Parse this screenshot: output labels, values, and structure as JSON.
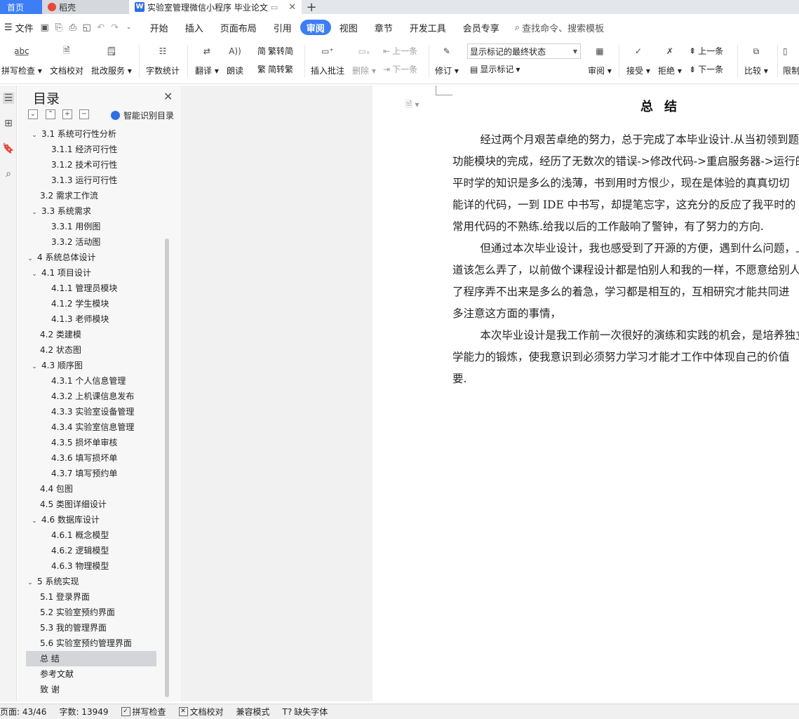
{
  "tabs": {
    "home": "首页",
    "daoke": "稻壳",
    "document": "实验室管理微信小程序 毕业论文",
    "add": "+"
  },
  "menubar": {
    "file": "文件",
    "items": [
      "开始",
      "插入",
      "页面布局",
      "引用",
      "审阅",
      "视图",
      "章节",
      "开发工具",
      "会员专享"
    ],
    "active": "审阅",
    "search": "查找命令、搜索模板"
  },
  "ribbon": {
    "spellcheck": "拼写检查",
    "doc_proof": "文档校对",
    "review_service": "批改服务",
    "word_count": "字数统计",
    "translate": "翻译",
    "read_aloud": "朗读",
    "trad_simp": "繁转简",
    "simp_trad": "简转繁",
    "insert_comment": "插入批注",
    "delete": "删除",
    "prev_comment": "上一条",
    "next_comment": "下一条",
    "revise": "修订",
    "show_markup_mode": "显示标记的最终状态",
    "show_markup": "显示标记",
    "review": "审阅",
    "accept": "接受",
    "reject": "拒绝",
    "prev_change": "上一条",
    "next_change": "下一条",
    "compare": "比较",
    "restrict": "限制"
  },
  "toc": {
    "title": "目录",
    "smart_detect": "智能识别目录",
    "items": [
      {
        "label": "3.1 系统可行性分析",
        "level": 2,
        "expanded": true
      },
      {
        "label": "3.1.1 经济可行性",
        "level": 3
      },
      {
        "label": "3.1.2 技术可行性",
        "level": 3
      },
      {
        "label": "3.1.3 运行可行性",
        "level": 3
      },
      {
        "label": "3.2 需求工作流",
        "level": 2
      },
      {
        "label": "3.3 系统需求",
        "level": 2,
        "expanded": true
      },
      {
        "label": "3.3.1 用例图",
        "level": 3
      },
      {
        "label": "3.3.2 活动图",
        "level": 3
      },
      {
        "label": "4 系统总体设计",
        "level": 1,
        "expanded": true
      },
      {
        "label": "4.1 项目设计",
        "level": 2,
        "expanded": true
      },
      {
        "label": "4.1.1 管理员模块",
        "level": 3
      },
      {
        "label": "4.1.2 学生模块",
        "level": 3
      },
      {
        "label": "4.1.3 老师模块",
        "level": 3
      },
      {
        "label": "4.2 类建模",
        "level": 2
      },
      {
        "label": "4.2  状态图",
        "level": 2
      },
      {
        "label": "4.3  顺序图",
        "level": 2,
        "expanded": true
      },
      {
        "label": "4.3.1 个人信息管理",
        "level": 3
      },
      {
        "label": "4.3.2 上机课信息发布",
        "level": 3
      },
      {
        "label": "4.3.3 实验室设备管理",
        "level": 3
      },
      {
        "label": "4.3.4 实验室信息管理",
        "level": 3
      },
      {
        "label": "4.3.5 损坏单审核",
        "level": 3
      },
      {
        "label": "4.3.6 填写损坏单",
        "level": 3
      },
      {
        "label": "4.3.7 填写预约单",
        "level": 3
      },
      {
        "label": "4.4  包图",
        "level": 2
      },
      {
        "label": "4.5 类图详细设计",
        "level": 2
      },
      {
        "label": "4.6  数据库设计",
        "level": 2,
        "expanded": true
      },
      {
        "label": "4.6.1  概念模型",
        "level": 3
      },
      {
        "label": "4.6.2  逻辑模型",
        "level": 3
      },
      {
        "label": "4.6.3  物理模型",
        "level": 3
      },
      {
        "label": "5 系统实现",
        "level": 1,
        "expanded": true
      },
      {
        "label": "5.1 登录界面",
        "level": 2
      },
      {
        "label": "5.2  实验室预约界面",
        "level": 2
      },
      {
        "label": "5.3  我的管理界面",
        "level": 2
      },
      {
        "label": "5.6  实验室预约管理界面",
        "level": 2
      },
      {
        "label": "总   结",
        "level": 1,
        "selected": true
      },
      {
        "label": "参考文献",
        "level": 1
      },
      {
        "label": "致   谢",
        "level": 1
      }
    ]
  },
  "document": {
    "heading": "总结",
    "paragraphs": [
      [
        "        经过两个月艰苦卓绝的努力，总于完成了本毕业设计.从当初领到题",
        "功能模块的完成，经历了无数次的错误->修改代码->重启服务器->运行的",
        "平时学的知识是多么的浅薄，书到用时方恨少，现在是体验的真真切切",
        "能详的代码，一到 IDE 中书写，却提笔忘字，这充分的反应了我平时的",
        "常用代码的不熟练.给我以后的工作敲响了警钟，有了努力的方向."
      ],
      [
        "        但通过本次毕业设计，我也感受到了开源的方便，遇到什么问题，上",
        "道该怎么弄了，以前做个课程设计都是怕别人和我的一样，不愿意给别人",
        "了程序弄不出来是多么的着急，学习都是相互的，互相研究才能共同进",
        "多注意这方面的事情，"
      ],
      [
        "        本次毕业设计是我工作前一次很好的演练和实践的机会，是培养独立",
        "学能力的锻炼，使我意识到必须努力学习才能才工作中体现自己的价值",
        "要."
      ]
    ]
  },
  "statusbar": {
    "page": "页面: 43/46",
    "words": "字数: 13949",
    "spellcheck": "拼写检查",
    "doc_proof": "文档校对",
    "compat": "兼容模式",
    "missing_font": "缺失字体"
  }
}
